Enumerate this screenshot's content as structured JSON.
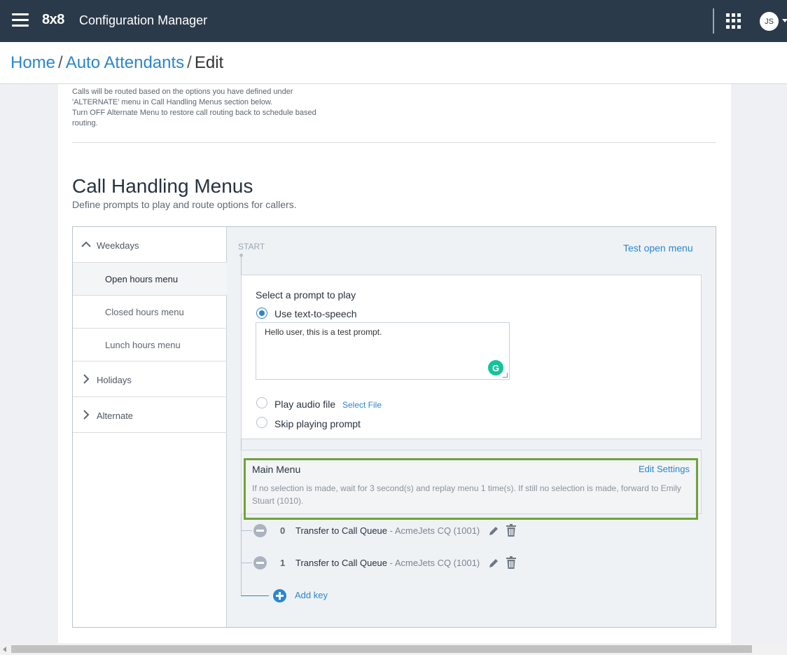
{
  "header": {
    "logo": "8x8",
    "app_title": "Configuration Manager",
    "avatar_initials": "JS"
  },
  "breadcrumb": {
    "home": "Home",
    "auto_attendants": "Auto Attendants",
    "current": "Edit",
    "separator": "/"
  },
  "alternate_description": [
    "Calls will be routed based on the options you have defined under",
    "'ALTERNATE' menu in Call Handling Menus section below.",
    "Turn OFF Alternate Menu to restore call routing back to schedule based",
    "routing."
  ],
  "call_handling": {
    "title": "Call Handling Menus",
    "subtitle": "Define prompts to play and route options for callers."
  },
  "nav": {
    "weekdays": "Weekdays",
    "items": [
      "Open hours menu",
      "Closed hours menu",
      "Lunch hours menu"
    ],
    "holidays": "Holidays",
    "alternate": "Alternate"
  },
  "flow": {
    "start_label": "START",
    "test_menu": "Test open menu"
  },
  "prompt": {
    "title": "Select a prompt to play",
    "tts_label": "Use text-to-speech",
    "tts_text": "Hello user, this is a test prompt.",
    "audio_label": "Play audio file",
    "select_file": "Select File",
    "skip_label": "Skip playing prompt",
    "selected": "tts"
  },
  "main_menu": {
    "title": "Main Menu",
    "edit_settings": "Edit Settings",
    "description": "If no selection is made, wait for 3 second(s) and replay menu 1 time(s). If still no selection is made, forward to Emily Stuart (1010)."
  },
  "keys": [
    {
      "key": "0",
      "action": "Transfer to Call Queue",
      "target": "- AcmeJets CQ (1001)"
    },
    {
      "key": "1",
      "action": "Transfer to Call Queue",
      "target": "- AcmeJets CQ (1001)"
    }
  ],
  "add_key": "Add key",
  "colors": {
    "topbar": "#2b3a4a",
    "link": "#2a86cf",
    "highlight": "#6fa33a",
    "grammarly": "#15c39a"
  }
}
